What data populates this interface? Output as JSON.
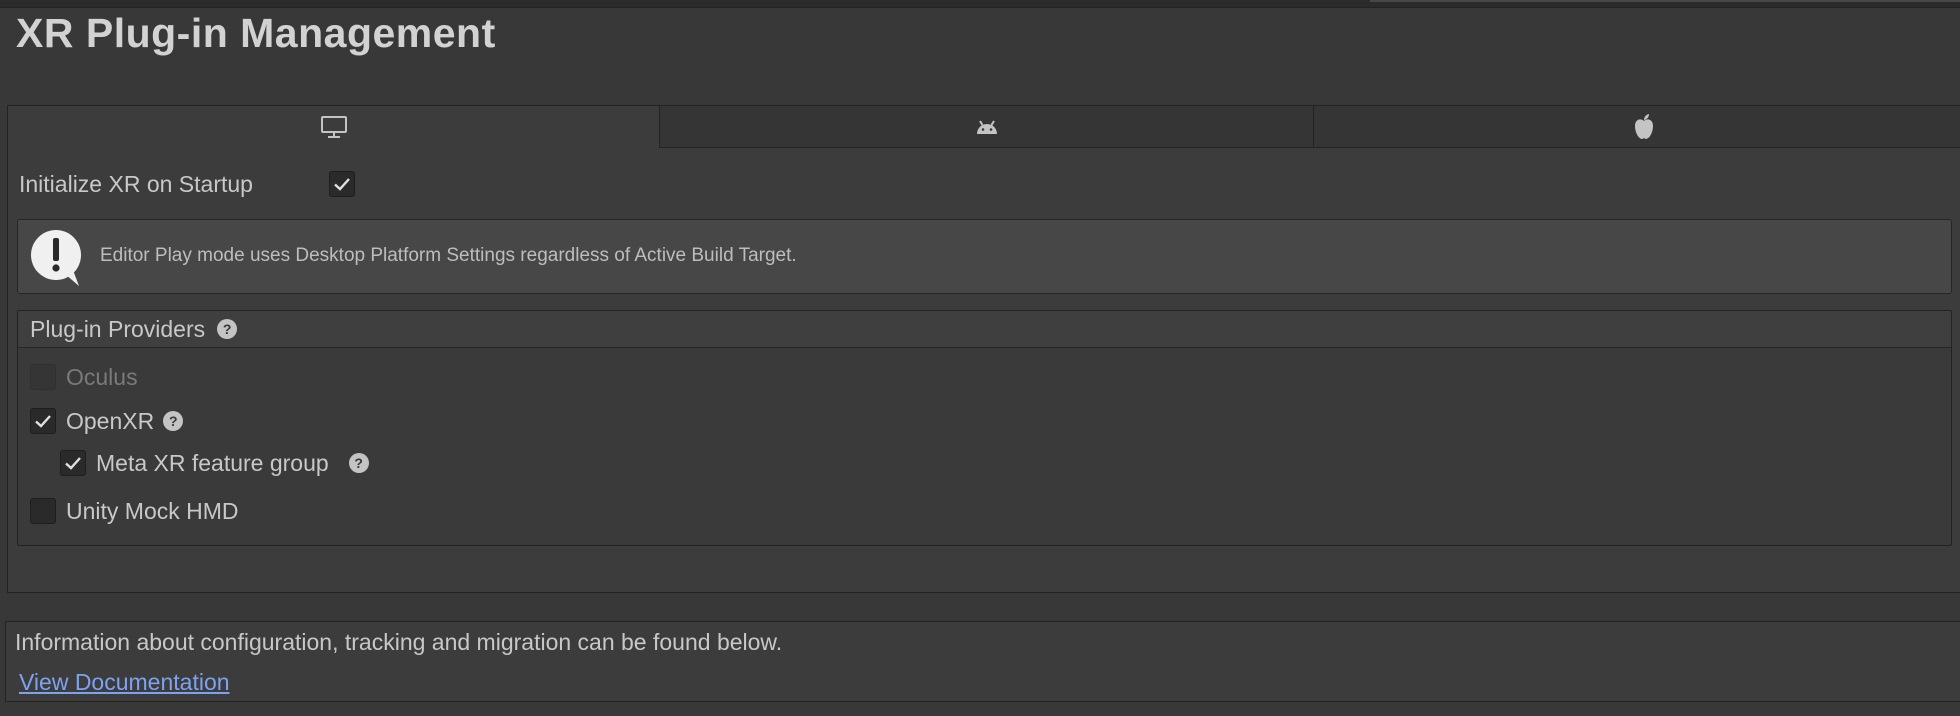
{
  "title": "XR Plug-in Management",
  "tabs": [
    {
      "icon": "desktop-monitor-icon",
      "active": true
    },
    {
      "icon": "android-icon",
      "active": false
    },
    {
      "icon": "apple-icon",
      "active": false
    }
  ],
  "init": {
    "label": "Initialize XR on Startup",
    "checked": true
  },
  "help": {
    "icon": "warning-exclamation-icon",
    "text": "Editor Play mode uses Desktop Platform Settings regardless of Active Build Target."
  },
  "providers": {
    "title": "Plug-in Providers",
    "items": [
      {
        "label": "Oculus",
        "checked": false,
        "disabled": true
      },
      {
        "label": "OpenXR",
        "checked": true,
        "disabled": false
      },
      {
        "label": "Meta XR feature group",
        "checked": true,
        "disabled": false
      },
      {
        "label": "Unity Mock HMD",
        "checked": false,
        "disabled": false
      }
    ]
  },
  "info": {
    "text": "Information about configuration, tracking and migration can be found below.",
    "link": "View Documentation"
  },
  "colors": {
    "background": "#383838",
    "link": "#7da2f0"
  }
}
